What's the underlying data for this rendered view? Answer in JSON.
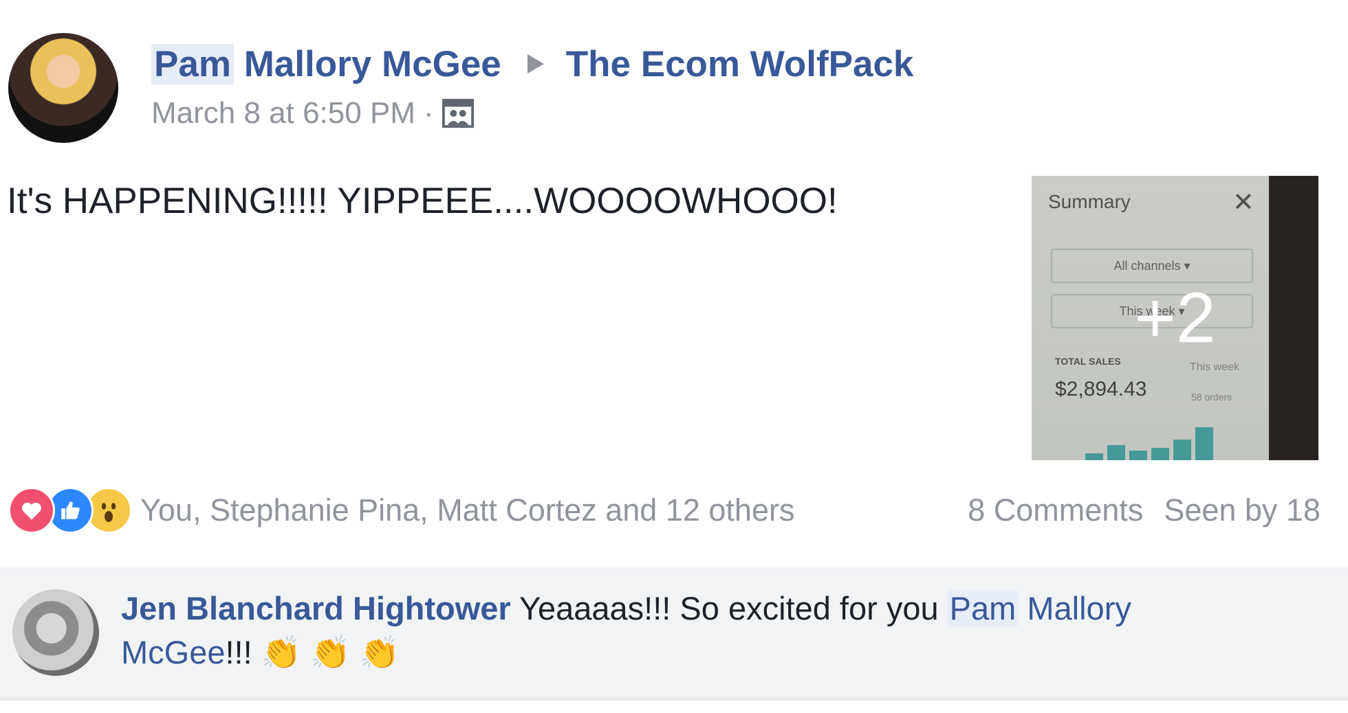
{
  "post": {
    "author_first": "Pam",
    "author_rest": "Mallory McGee",
    "group": "The Ecom WolfPack",
    "timestamp": "March 8 at 6:50 PM",
    "separator": "·",
    "privacy_icon": "group-icon",
    "text": "It's HAPPENING!!!!! YIPPEEE....WOOOOWHOOO!"
  },
  "thumbnail": {
    "title": "Summary",
    "close": "✕",
    "select_channels": "All channels ▾",
    "select_range": "This week ▾",
    "label": "TOTAL SALES",
    "period": "This week",
    "amount": "$2,894.43",
    "orders": "58 orders",
    "more_count": "+2"
  },
  "reactions": {
    "icons": [
      "love-icon",
      "like-icon",
      "wow-icon"
    ],
    "names": "You, Stephanie Pina, Matt Cortez and 12 others",
    "comments": "8 Comments",
    "seen": "Seen by 18"
  },
  "comment": {
    "author": "Jen Blanchard Hightower",
    "text": "Yeaaaas!!! So excited for you",
    "mention_first": "Pam",
    "mention_rest": "Mallory McGee",
    "suffix": "!!!",
    "emoji": "👏 👏 👏"
  },
  "colors": {
    "link": "#385898",
    "meta": "#90949c",
    "comment_bg": "#f2f3f5"
  }
}
